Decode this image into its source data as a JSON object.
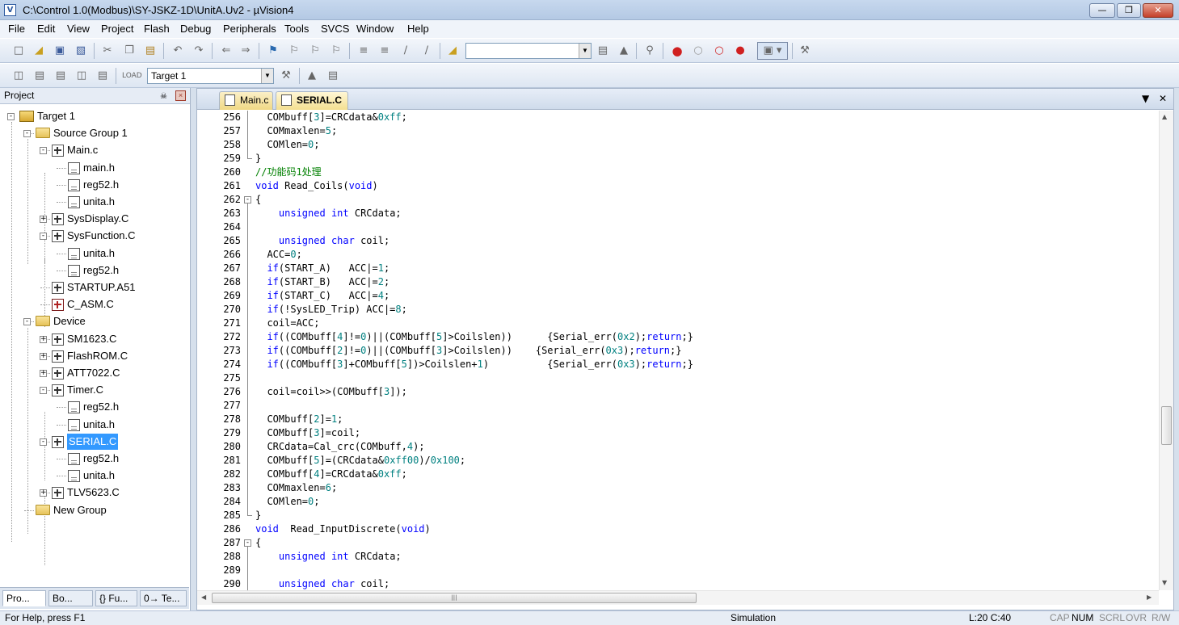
{
  "window": {
    "title": "C:\\Control 1.0(Modbus)\\SY-JSKZ-1D\\UnitA.Uv2 - µVision4",
    "app_icon": "V"
  },
  "menu": [
    "File",
    "Edit",
    "View",
    "Project",
    "Flash",
    "Debug",
    "Peripherals",
    "Tools",
    "SVCS",
    "Window",
    "Help"
  ],
  "toolbar": {
    "find_combo_value": "",
    "target_combo_value": "Target 1"
  },
  "project_panel": {
    "title": "Project",
    "tree": [
      {
        "label": "Target 1",
        "icon": "target-icon",
        "expand": "-"
      },
      {
        "label": "Source Group 1",
        "icon": "folder-icon",
        "expand": "-"
      },
      {
        "label": "Main.c",
        "icon": "c-file-icon",
        "expand": "-"
      },
      {
        "label": "main.h",
        "icon": "h-file-icon"
      },
      {
        "label": "reg52.h",
        "icon": "h-file-icon"
      },
      {
        "label": "unita.h",
        "icon": "h-file-icon"
      },
      {
        "label": "SysDisplay.C",
        "icon": "c-file-icon",
        "expand": "+"
      },
      {
        "label": "SysFunction.C",
        "icon": "c-file-icon",
        "expand": "-"
      },
      {
        "label": "unita.h",
        "icon": "h-file-icon"
      },
      {
        "label": "reg52.h",
        "icon": "h-file-icon"
      },
      {
        "label": "STARTUP.A51",
        "icon": "c-file-icon"
      },
      {
        "label": "C_ASM.C",
        "icon": "asm-file-icon"
      },
      {
        "label": "Device",
        "icon": "folder-icon",
        "expand": "-"
      },
      {
        "label": "SM1623.C",
        "icon": "c-file-icon",
        "expand": "+"
      },
      {
        "label": "FlashROM.C",
        "icon": "c-file-icon",
        "expand": "+"
      },
      {
        "label": "ATT7022.C",
        "icon": "c-file-icon",
        "expand": "+"
      },
      {
        "label": "Timer.C",
        "icon": "c-file-icon",
        "expand": "-"
      },
      {
        "label": "reg52.h",
        "icon": "h-file-icon"
      },
      {
        "label": "unita.h",
        "icon": "h-file-icon"
      },
      {
        "label": "SERIAL.C",
        "icon": "c-file-icon",
        "expand": "-",
        "selected": true
      },
      {
        "label": "reg52.h",
        "icon": "h-file-icon"
      },
      {
        "label": "unita.h",
        "icon": "h-file-icon"
      },
      {
        "label": "TLV5623.C",
        "icon": "c-file-icon",
        "expand": "+"
      },
      {
        "label": "New Group",
        "icon": "folder-icon"
      }
    ],
    "tabs": [
      "Pro...",
      "Bo...",
      "{} Fu...",
      "0→ Te..."
    ]
  },
  "editor": {
    "tabs": [
      {
        "label": "Main.c",
        "active": false
      },
      {
        "label": "SERIAL.C",
        "active": true
      }
    ],
    "lines": [
      {
        "n": "256",
        "f": "v",
        "h": "  COMbuff[<n>3</n>]=CRCdata&amp;<n>0xff</n>;"
      },
      {
        "n": "257",
        "f": "v",
        "h": "  COMmaxlen=<n>5</n>;"
      },
      {
        "n": "258",
        "f": "v",
        "h": "  COMlen=<n>0</n>;"
      },
      {
        "n": "259",
        "f": "e",
        "h": "}"
      },
      {
        "n": "260",
        "f": "",
        "h": "<c>//功能码1处理</c>"
      },
      {
        "n": "261",
        "f": "",
        "h": "<k>void</k> Read_Coils(<k>void</k>)"
      },
      {
        "n": "262",
        "f": "b",
        "h": "{"
      },
      {
        "n": "263",
        "f": "v",
        "h": "    <k>unsigned</k> <k>int</k> CRCdata;"
      },
      {
        "n": "264",
        "f": "v",
        "h": ""
      },
      {
        "n": "265",
        "f": "v",
        "h": "    <k>unsigned</k> <k>char</k> coil;"
      },
      {
        "n": "266",
        "f": "v",
        "h": "  ACC=<n>0</n>;"
      },
      {
        "n": "267",
        "f": "v",
        "h": "  <k>if</k>(START_A)   ACC|=<n>1</n>;"
      },
      {
        "n": "268",
        "f": "v",
        "h": "  <k>if</k>(START_B)   ACC|=<n>2</n>;"
      },
      {
        "n": "269",
        "f": "v",
        "h": "  <k>if</k>(START_C)   ACC|=<n>4</n>;"
      },
      {
        "n": "270",
        "f": "v",
        "h": "  <k>if</k>(!SysLED_Trip) ACC|=<n>8</n>;"
      },
      {
        "n": "271",
        "f": "v",
        "h": "  coil=ACC;"
      },
      {
        "n": "272",
        "f": "v",
        "h": "  <k>if</k>((COMbuff[<n>4</n>]!=<n>0</n>)||(COMbuff[<n>5</n>]&gt;Coilslen))      {Serial_err(<n>0x2</n>);<k>return</k>;}"
      },
      {
        "n": "273",
        "f": "v",
        "h": "  <k>if</k>((COMbuff[<n>2</n>]!=<n>0</n>)||(COMbuff[<n>3</n>]&gt;Coilslen))    {Serial_err(<n>0x3</n>);<k>return</k>;}"
      },
      {
        "n": "274",
        "f": "v",
        "h": "  <k>if</k>((COMbuff[<n>3</n>]+COMbuff[<n>5</n>])&gt;Coilslen+<n>1</n>)          {Serial_err(<n>0x3</n>);<k>return</k>;}"
      },
      {
        "n": "275",
        "f": "v",
        "h": ""
      },
      {
        "n": "276",
        "f": "v",
        "h": "  coil=coil&gt;&gt;(COMbuff[<n>3</n>]);"
      },
      {
        "n": "277",
        "f": "v",
        "h": ""
      },
      {
        "n": "278",
        "f": "v",
        "h": "  COMbuff[<n>2</n>]=<n>1</n>;"
      },
      {
        "n": "279",
        "f": "v",
        "h": "  COMbuff[<n>3</n>]=coil;"
      },
      {
        "n": "280",
        "f": "v",
        "h": "  CRCdata=Cal_crc(COMbuff,<n>4</n>);"
      },
      {
        "n": "281",
        "f": "v",
        "h": "  COMbuff[<n>5</n>]=(CRCdata&amp;<n>0xff00</n>)/<n>0x100</n>;"
      },
      {
        "n": "282",
        "f": "v",
        "h": "  COMbuff[<n>4</n>]=CRCdata&amp;<n>0xff</n>;"
      },
      {
        "n": "283",
        "f": "v",
        "h": "  COMmaxlen=<n>6</n>;"
      },
      {
        "n": "284",
        "f": "v",
        "h": "  COMlen=<n>0</n>;"
      },
      {
        "n": "285",
        "f": "e",
        "h": "}"
      },
      {
        "n": "286",
        "f": "",
        "h": "<k>void</k>  Read_InputDiscrete(<k>void</k>)"
      },
      {
        "n": "287",
        "f": "b",
        "h": "{"
      },
      {
        "n": "288",
        "f": "v",
        "h": "    <k>unsigned</k> <k>int</k> CRCdata;"
      },
      {
        "n": "289",
        "f": "v",
        "h": ""
      },
      {
        "n": "290",
        "f": "v",
        "h": "    <k>unsigned</k> <k>char</k> coil;"
      }
    ]
  },
  "status": {
    "help": "For Help, press F1",
    "mode": "Simulation",
    "position": "L:20 C:40",
    "indicators": [
      {
        "label": "CAP",
        "on": false
      },
      {
        "label": "NUM",
        "on": true
      },
      {
        "label": "SCRL",
        "on": false
      },
      {
        "label": "OVR",
        "on": false
      },
      {
        "label": "R/W",
        "on": false
      }
    ]
  },
  "colors": {
    "keyword": "#0000ff",
    "number": "#008080",
    "comment": "#008000",
    "selection": "#3399ff"
  }
}
